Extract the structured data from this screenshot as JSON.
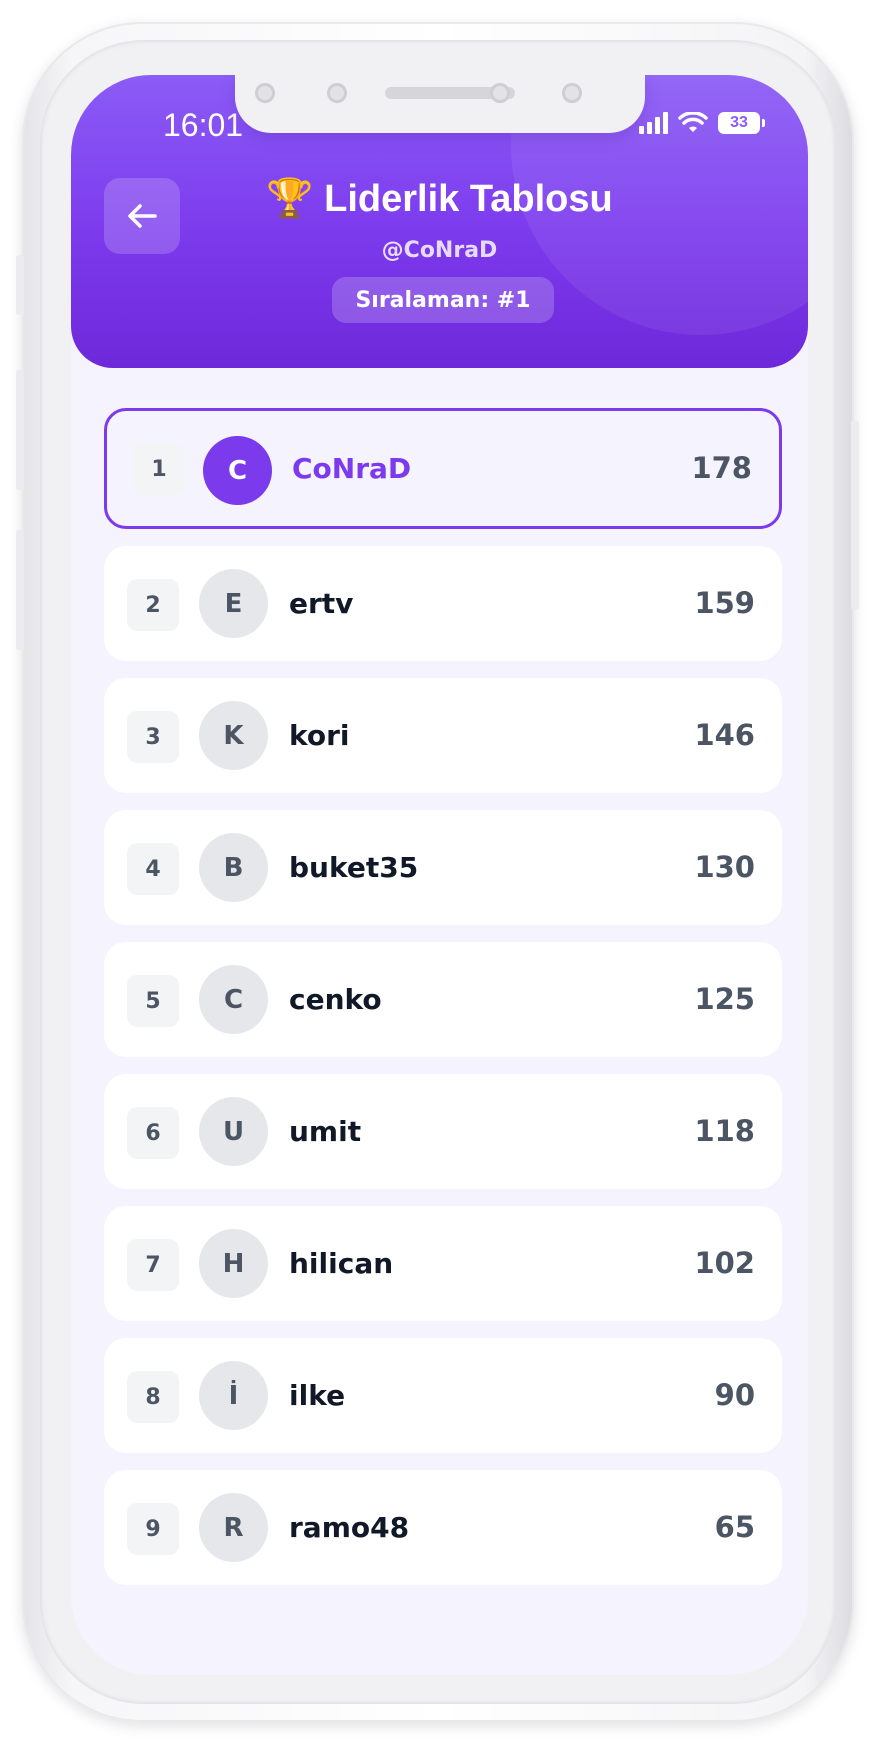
{
  "status_bar": {
    "time": "16:01",
    "battery": "33"
  },
  "header": {
    "title_emoji": "🏆",
    "title": "Liderlik Tablosu",
    "username": "@CoNraD",
    "rank_label": "Sıralaman: #1"
  },
  "leaderboard": [
    {
      "rank": "1",
      "initial": "C",
      "name": "CoNraD",
      "score": "178",
      "is_me": true
    },
    {
      "rank": "2",
      "initial": "E",
      "name": "ertv",
      "score": "159"
    },
    {
      "rank": "3",
      "initial": "K",
      "name": "kori",
      "score": "146"
    },
    {
      "rank": "4",
      "initial": "B",
      "name": "buket35",
      "score": "130"
    },
    {
      "rank": "5",
      "initial": "C",
      "name": "cenko",
      "score": "125"
    },
    {
      "rank": "6",
      "initial": "U",
      "name": "umit",
      "score": "118"
    },
    {
      "rank": "7",
      "initial": "H",
      "name": "hilican",
      "score": "102"
    },
    {
      "rank": "8",
      "initial": "İ",
      "name": "ilke",
      "score": "90"
    },
    {
      "rank": "9",
      "initial": "R",
      "name": "ramo48",
      "score": "65"
    }
  ],
  "colors": {
    "accent": "#7c3aed",
    "header_top": "#8b5cf6",
    "background": "#f5f3fe"
  },
  "icons": {
    "back": "arrow-left-icon",
    "wifi": "wifi-icon",
    "signal": "cellular-signal-icon",
    "battery": "battery-icon"
  }
}
